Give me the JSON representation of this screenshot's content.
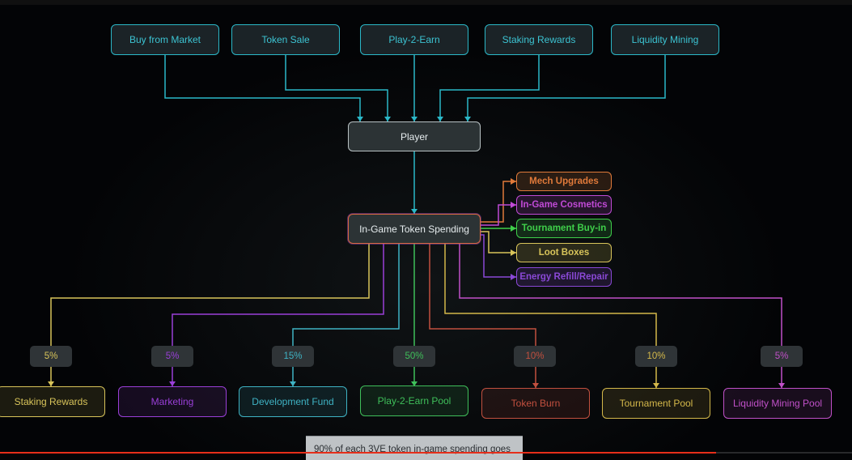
{
  "sources": [
    {
      "label": "Buy from Market"
    },
    {
      "label": "Token Sale"
    },
    {
      "label": "Play-2-Earn"
    },
    {
      "label": "Staking Rewards"
    },
    {
      "label": "Liquidity Mining"
    }
  ],
  "player": {
    "label": "Player"
  },
  "spending": {
    "label": "In-Game Token Spending"
  },
  "uses": [
    {
      "label": "Mech Upgrades",
      "color": "#e07a3a"
    },
    {
      "label": "In-Game Cosmetics",
      "color": "#c04ad6"
    },
    {
      "label": "Tournament Buy-in",
      "color": "#3fcf4a"
    },
    {
      "label": "Loot Boxes",
      "color": "#d8c45a"
    },
    {
      "label": "Energy Refill/Repair",
      "color": "#8a48d6"
    }
  ],
  "allocations": [
    {
      "percent": "5%",
      "label": "Staking Rewards",
      "color": "#d8c45a"
    },
    {
      "percent": "5%",
      "label": "Marketing",
      "color": "#9a3fd8"
    },
    {
      "percent": "15%",
      "label": "Development Fund",
      "color": "#3fb3c4"
    },
    {
      "percent": "50%",
      "label": "Play-2-Earn Pool",
      "color": "#3fbf5a"
    },
    {
      "percent": "10%",
      "label": "Token Burn",
      "color": "#c2503f"
    },
    {
      "percent": "10%",
      "label": "Tournament Pool",
      "color": "#d4b84a"
    },
    {
      "percent": "5%",
      "label": "Liquidity Mining Pool",
      "color": "#c050c8"
    }
  ],
  "caption": {
    "text": "90% of each 3VE token in-game spending goes"
  },
  "video_progress": 0.84,
  "colors": {
    "source": "#2bb8c8",
    "progress": "#e62e1a"
  }
}
